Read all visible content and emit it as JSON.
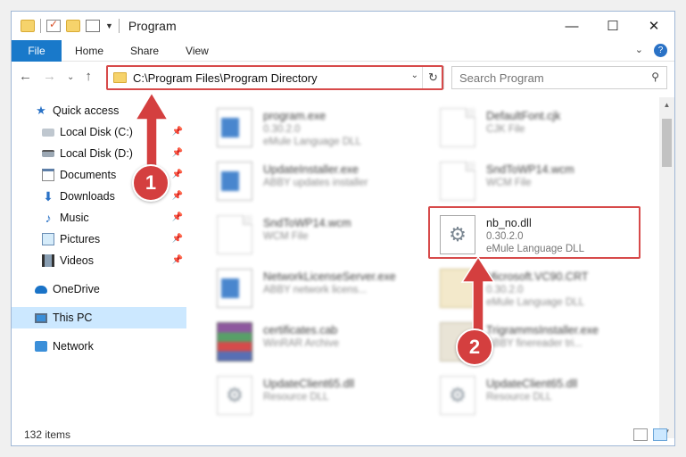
{
  "title_bar": {
    "title": "Program",
    "minimize": "—",
    "maximize": "☐",
    "close": "✕"
  },
  "ribbon": {
    "tabs": [
      "File",
      "Home",
      "Share",
      "View"
    ],
    "expand": "⌄",
    "help": "?"
  },
  "navigation": {
    "back": "←",
    "forward": "→",
    "recent": "⌄",
    "up": "↑"
  },
  "address_bar": {
    "path": "C:\\Program Files\\Program Directory",
    "dropdown": "⌄",
    "refresh": "↻"
  },
  "search": {
    "placeholder": "Search Program",
    "icon": "⚲"
  },
  "sidebar": {
    "items": [
      {
        "label": "Quick access",
        "icon": "star-icon",
        "pinned": false
      },
      {
        "label": "Local Disk (C:)",
        "icon": "disk-icon",
        "pinned": true
      },
      {
        "label": "Local Disk (D:)",
        "icon": "disk-icon",
        "pinned": true
      },
      {
        "label": "Documents",
        "icon": "documents-icon",
        "pinned": true
      },
      {
        "label": "Downloads",
        "icon": "download-icon",
        "pinned": true
      },
      {
        "label": "Music",
        "icon": "music-icon",
        "pinned": true
      },
      {
        "label": "Pictures",
        "icon": "pictures-icon",
        "pinned": true
      },
      {
        "label": "Videos",
        "icon": "videos-icon",
        "pinned": true
      },
      {
        "label": "OneDrive",
        "icon": "cloud-icon",
        "pinned": false
      },
      {
        "label": "This PC",
        "icon": "computer-icon",
        "pinned": false,
        "selected": true
      },
      {
        "label": "Network",
        "icon": "network-icon",
        "pinned": false
      }
    ],
    "pin_glyph": "📌"
  },
  "files": [
    {
      "name": "program.exe",
      "line2": "0.30.2.0",
      "line3": "eMule Language DLL",
      "icon": "application-icon"
    },
    {
      "name": "DefaultFont.cjk",
      "line2": "CJK File",
      "line3": "",
      "icon": "blank-file-icon"
    },
    {
      "name": "UpdateInstaller.exe",
      "line2": "ABBY updates installer",
      "line3": "",
      "icon": "application-icon"
    },
    {
      "name": "SndToWP14.wcm",
      "line2": "WCM File",
      "line3": "",
      "icon": "blank-file-icon"
    },
    {
      "name": "SndToWP14.wcm",
      "line2": "WCM File",
      "line3": "",
      "icon": "blank-file-icon"
    },
    {
      "name": "nb_no.dll",
      "line2": "0.30.2.0",
      "line3": "eMule Language DLL",
      "icon": "dll-gear-icon"
    },
    {
      "name": "NetworkLicenseServer.exe",
      "line2": "ABBY network licens...",
      "line3": "",
      "icon": "application-icon"
    },
    {
      "name": "Microsoft.VC90.CRT",
      "line2": "0.30.2.0",
      "line3": "eMule Language DLL",
      "icon": "folder-icon"
    },
    {
      "name": "certificates.cab",
      "line2": "WinRAR Archive",
      "line3": "",
      "icon": "archive-icon"
    },
    {
      "name": "TrigrammsInstaller.exe",
      "line2": "ABBY finereader tri...",
      "line3": "",
      "icon": "installer-icon"
    },
    {
      "name": "UpdateClient65.dll",
      "line2": "Resource DLL",
      "line3": "",
      "icon": "dll-gear-icon"
    },
    {
      "name": "UpdateClient65.dll",
      "line2": "Resource DLL",
      "line3": "",
      "icon": "dll-gear-icon"
    }
  ],
  "annotations": {
    "step1": "1",
    "step2": "2",
    "accent": "#d43f3f"
  },
  "status_bar": {
    "item_count": "132 items"
  },
  "scrollbar": {
    "up": "▲",
    "down": "▼"
  }
}
